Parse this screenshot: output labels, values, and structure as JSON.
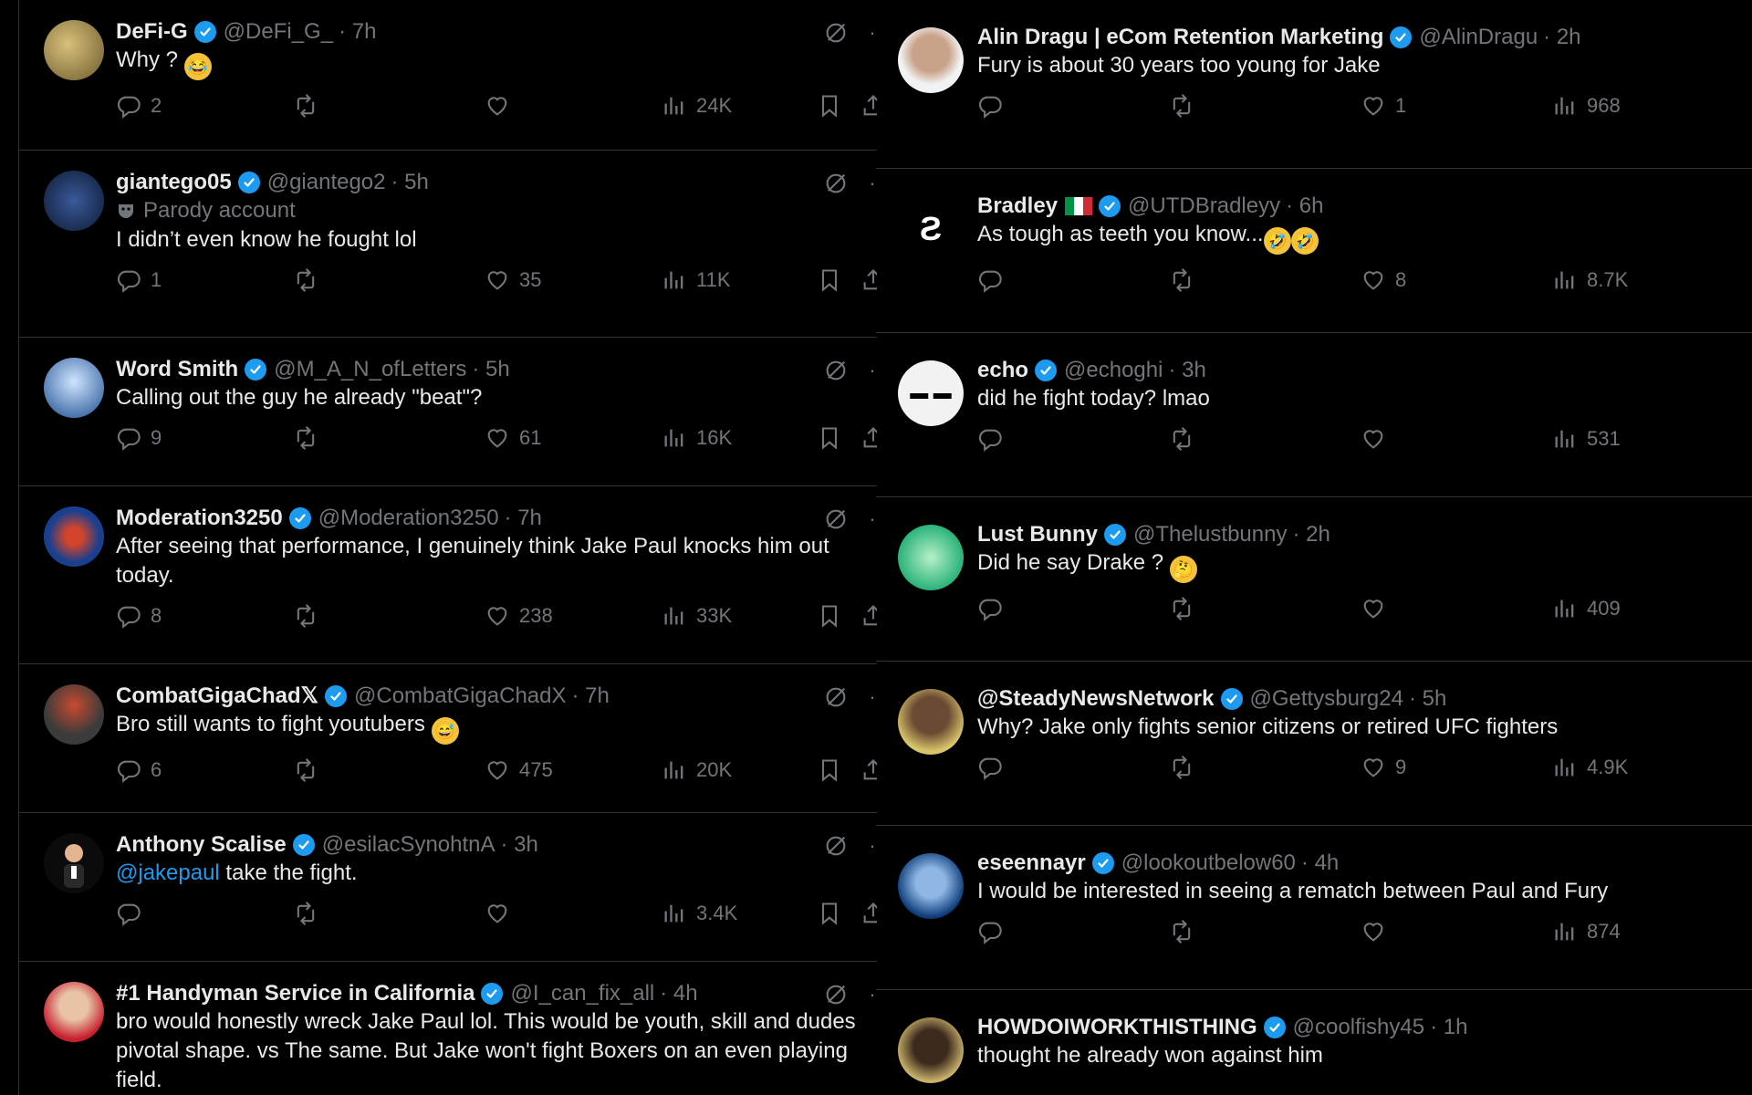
{
  "left": [
    {
      "name": "DeFi-G",
      "handle": "@DeFi_G_",
      "time": "· 7h",
      "text": "Why ?",
      "replies": "2",
      "likes": "",
      "views": "24K"
    },
    {
      "name": "giantego05",
      "handle": "@giantego2",
      "time": "· 5h",
      "parody": "Parody account",
      "text": "I didn’t even know he fought lol",
      "replies": "1",
      "likes": "35",
      "views": "11K"
    },
    {
      "name": "Word Smith",
      "handle": "@M_A_N_ofLetters",
      "time": "· 5h",
      "text": "Calling out the guy he already \"beat\"?",
      "replies": "9",
      "likes": "61",
      "views": "16K"
    },
    {
      "name": "Moderation3250",
      "handle": "@Moderation3250",
      "time": "· 7h",
      "text": "After seeing that performance, I genuinely think Jake Paul knocks him out today.",
      "replies": "8",
      "likes": "238",
      "views": "33K"
    },
    {
      "name": "CombatGigaChad𝕏",
      "handle": "@CombatGigaChadX",
      "time": "· 7h",
      "text": "Bro still wants to fight youtubers",
      "replies": "6",
      "likes": "475",
      "views": "20K"
    },
    {
      "name": "Anthony Scalise",
      "handle": "@esilacSynohtnA",
      "time": "· 3h",
      "mention": "@jakepaul",
      "text": " take the fight.",
      "replies": "",
      "likes": "",
      "views": "3.4K"
    },
    {
      "name": "#1 Handyman Service in California",
      "handle": "@I_can_fix_all",
      "time": "· 4h",
      "text": "bro would honestly wreck Jake Paul lol. This would be youth, skill and dudes pivotal shape. vs The same. But Jake won't fight Boxers on an even playing field.",
      "replies": "",
      "likes": "",
      "views": ""
    }
  ],
  "right": [
    {
      "name": "Alin Dragu | eCom Retention Marketing",
      "handle": "@AlinDragu",
      "time": "· 2h",
      "text": "Fury is about 30 years too young for Jake",
      "replies": "",
      "likes": "1",
      "views": "968"
    },
    {
      "name": "Bradley",
      "handle": "@UTDBradleyy",
      "time": "· 6h",
      "text": "As tough as teeth you know...",
      "replies": "",
      "likes": "8",
      "views": "8.7K"
    },
    {
      "name": "echo",
      "handle": "@echoghi",
      "time": "· 3h",
      "text": "did he fight today? lmao",
      "replies": "",
      "likes": "",
      "views": "531"
    },
    {
      "name": "Lust Bunny",
      "handle": "@Thelustbunny",
      "time": "· 2h",
      "text": "Did he say Drake ?",
      "replies": "",
      "likes": "",
      "views": "409"
    },
    {
      "name": "@SteadyNewsNetwork",
      "handle": "@Gettysburg24",
      "time": "· 5h",
      "text": "Why? Jake only fights senior citizens or retired UFC fighters",
      "replies": "",
      "likes": "9",
      "views": "4.9K"
    },
    {
      "name": "eseennayr",
      "handle": "@lookoutbelow60",
      "time": "· 4h",
      "text": "I would be interested in seeing a rematch between Paul and Fury",
      "replies": "",
      "likes": "",
      "views": "874"
    },
    {
      "name": "HOWDOIWORKTHISTHING",
      "handle": "@coolfishy45",
      "time": "· 1h",
      "text": "thought he already won against him",
      "replies": "",
      "likes": "",
      "views": ""
    }
  ],
  "colors": {
    "verified": "#1d9bf0",
    "muted": "#71767b",
    "text": "#e7e9ea",
    "border": "#2f3336"
  }
}
